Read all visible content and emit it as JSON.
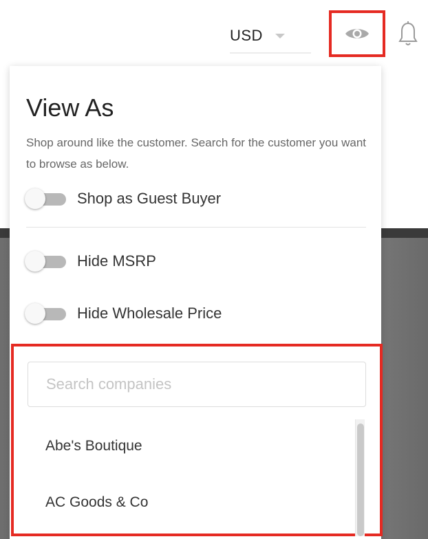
{
  "header": {
    "currency": "USD",
    "eye_icon": "eye-icon",
    "bell_icon": "bell-icon"
  },
  "view_as": {
    "title": "View As",
    "description": "Shop around like the customer. Search for the customer you want to browse as below.",
    "toggles": [
      {
        "label": "Shop as Guest Buyer",
        "on": false
      },
      {
        "label": "Hide MSRP",
        "on": false
      },
      {
        "label": "Hide Wholesale Price",
        "on": false
      }
    ],
    "search": {
      "placeholder": "Search companies",
      "value": ""
    },
    "companies": [
      "Abe's Boutique",
      "AC Goods & Co"
    ]
  },
  "colors": {
    "highlight": "#e52a22",
    "toggle_off": "#b8b8b8",
    "text": "#333333"
  }
}
